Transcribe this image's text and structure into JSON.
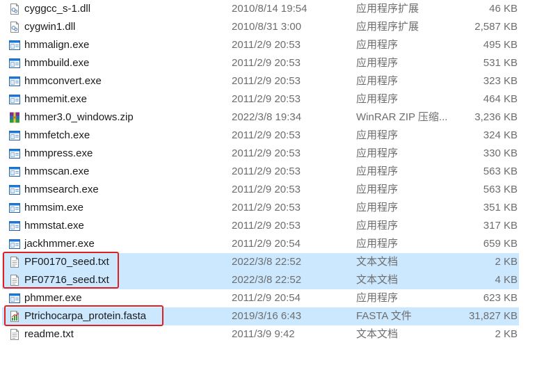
{
  "files": [
    {
      "name": "cyggcc_s-1.dll",
      "date": "2010/8/14 19:54",
      "type": "应用程序扩展",
      "size": "46 KB",
      "icon": "dll-icon",
      "selected": false
    },
    {
      "name": "cygwin1.dll",
      "date": "2010/8/31 3:00",
      "type": "应用程序扩展",
      "size": "2,587 KB",
      "icon": "dll-icon",
      "selected": false
    },
    {
      "name": "hmmalign.exe",
      "date": "2011/2/9 20:53",
      "type": "应用程序",
      "size": "495 KB",
      "icon": "exe-icon",
      "selected": false
    },
    {
      "name": "hmmbuild.exe",
      "date": "2011/2/9 20:53",
      "type": "应用程序",
      "size": "531 KB",
      "icon": "exe-icon",
      "selected": false
    },
    {
      "name": "hmmconvert.exe",
      "date": "2011/2/9 20:53",
      "type": "应用程序",
      "size": "323 KB",
      "icon": "exe-icon",
      "selected": false
    },
    {
      "name": "hmmemit.exe",
      "date": "2011/2/9 20:53",
      "type": "应用程序",
      "size": "464 KB",
      "icon": "exe-icon",
      "selected": false
    },
    {
      "name": "hmmer3.0_windows.zip",
      "date": "2022/3/8 19:34",
      "type": "WinRAR ZIP 压缩...",
      "size": "3,236 KB",
      "icon": "winrar-archive-icon",
      "selected": false
    },
    {
      "name": "hmmfetch.exe",
      "date": "2011/2/9 20:53",
      "type": "应用程序",
      "size": "324 KB",
      "icon": "exe-icon",
      "selected": false
    },
    {
      "name": "hmmpress.exe",
      "date": "2011/2/9 20:53",
      "type": "应用程序",
      "size": "330 KB",
      "icon": "exe-icon",
      "selected": false
    },
    {
      "name": "hmmscan.exe",
      "date": "2011/2/9 20:53",
      "type": "应用程序",
      "size": "563 KB",
      "icon": "exe-icon",
      "selected": false
    },
    {
      "name": "hmmsearch.exe",
      "date": "2011/2/9 20:53",
      "type": "应用程序",
      "size": "563 KB",
      "icon": "exe-icon",
      "selected": false
    },
    {
      "name": "hmmsim.exe",
      "date": "2011/2/9 20:53",
      "type": "应用程序",
      "size": "351 KB",
      "icon": "exe-icon",
      "selected": false
    },
    {
      "name": "hmmstat.exe",
      "date": "2011/2/9 20:53",
      "type": "应用程序",
      "size": "317 KB",
      "icon": "exe-icon",
      "selected": false
    },
    {
      "name": "jackhmmer.exe",
      "date": "2011/2/9 20:54",
      "type": "应用程序",
      "size": "659 KB",
      "icon": "exe-icon",
      "selected": false
    },
    {
      "name": "PF00170_seed.txt",
      "date": "2022/3/8 22:52",
      "type": "文本文档",
      "size": "2 KB",
      "icon": "text-file-icon",
      "selected": true
    },
    {
      "name": "PF07716_seed.txt",
      "date": "2022/3/8 22:52",
      "type": "文本文档",
      "size": "4 KB",
      "icon": "text-file-icon",
      "selected": true
    },
    {
      "name": "phmmer.exe",
      "date": "2011/2/9 20:54",
      "type": "应用程序",
      "size": "623 KB",
      "icon": "exe-icon",
      "selected": false
    },
    {
      "name": "Ptrichocarpa_protein.fasta",
      "date": "2019/3/16 6:43",
      "type": "FASTA 文件",
      "size": "31,827 KB",
      "icon": "fasta-file-icon",
      "selected": true
    },
    {
      "name": "readme.txt",
      "date": "2011/3/9 9:42",
      "type": "文本文档",
      "size": "2 KB",
      "icon": "text-file-icon",
      "selected": false
    }
  ],
  "colors": {
    "selection": "#cce8ff",
    "annotation_border": "#e02020",
    "secondary_text": "#6d6d6d"
  }
}
